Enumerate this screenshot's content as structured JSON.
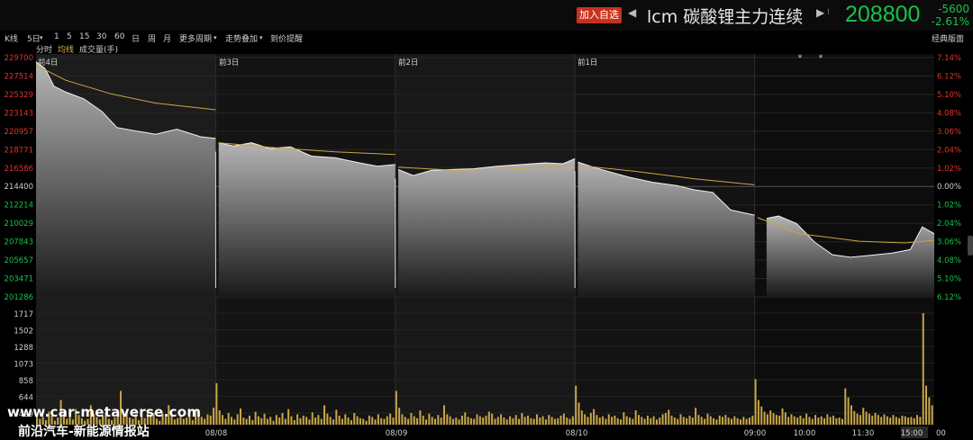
{
  "header": {
    "add_watchlist": "加入自选",
    "symbol": "lcm",
    "name": "碳酸锂主力连续",
    "price": "208800",
    "change": "-5600",
    "change_pct": "-2.61%",
    "price_color": "#17c24b"
  },
  "toolbar": {
    "items": [
      "K线",
      "5日",
      "1",
      "5",
      "15",
      "30",
      "60",
      "日",
      "周",
      "月",
      "更多周期",
      "走势叠加",
      "到价提醒"
    ],
    "right": "经典版面"
  },
  "subbar": {
    "items": [
      "分时",
      "均线",
      "成交量(手)"
    ]
  },
  "chart_data": {
    "type": "line",
    "day_labels": [
      "前4日",
      "前3日",
      "前2日",
      "前1日"
    ],
    "price_axis": [
      "229700",
      "227514",
      "225329",
      "223143",
      "220957",
      "218771",
      "216586",
      "214400",
      "212214",
      "210029",
      "207843",
      "205657",
      "203471",
      "201286"
    ],
    "pct_axis": [
      "7.14%",
      "6.12%",
      "5.10%",
      "4.08%",
      "3.06%",
      "2.04%",
      "1.02%",
      "0.00%",
      "1.02%",
      "2.04%",
      "3.06%",
      "4.08%",
      "5.10%",
      "6.12%"
    ],
    "volume_axis": [
      "1717",
      "1502",
      "1288",
      "1073",
      "858",
      "644",
      "429"
    ],
    "x_labels": [
      "08/08",
      "08/09",
      "08/10",
      "09:00",
      "10:00",
      "11:30",
      "15:00"
    ],
    "x_edge_label": "00",
    "reference_price": 214400,
    "price_series": [
      {
        "t": 0,
        "p": 229200
      },
      {
        "t": 3,
        "p": 228400
      },
      {
        "t": 6,
        "p": 226300
      },
      {
        "t": 10,
        "p": 225600
      },
      {
        "t": 16,
        "p": 224800
      },
      {
        "t": 22,
        "p": 223300
      },
      {
        "t": 27,
        "p": 221400
      },
      {
        "t": 33,
        "p": 221000
      },
      {
        "t": 40,
        "p": 220600
      },
      {
        "t": 47,
        "p": 221200
      },
      {
        "t": 55,
        "p": 220300
      },
      {
        "t": 60,
        "p": 220100
      },
      {
        "t": 61,
        "p": 219600
      },
      {
        "t": 66,
        "p": 219200
      },
      {
        "t": 72,
        "p": 219600
      },
      {
        "t": 78,
        "p": 218900
      },
      {
        "t": 85,
        "p": 219100
      },
      {
        "t": 92,
        "p": 218000
      },
      {
        "t": 100,
        "p": 217800
      },
      {
        "t": 108,
        "p": 217200
      },
      {
        "t": 114,
        "p": 216800
      },
      {
        "t": 120,
        "p": 217000
      },
      {
        "t": 121,
        "p": 216400
      },
      {
        "t": 126,
        "p": 215700
      },
      {
        "t": 132,
        "p": 216300
      },
      {
        "t": 138,
        "p": 216400
      },
      {
        "t": 146,
        "p": 216500
      },
      {
        "t": 154,
        "p": 216800
      },
      {
        "t": 162,
        "p": 217000
      },
      {
        "t": 170,
        "p": 217200
      },
      {
        "t": 176,
        "p": 217100
      },
      {
        "t": 180,
        "p": 217700
      },
      {
        "t": 181,
        "p": 217300
      },
      {
        "t": 186,
        "p": 216700
      },
      {
        "t": 192,
        "p": 216100
      },
      {
        "t": 198,
        "p": 215500
      },
      {
        "t": 206,
        "p": 214900
      },
      {
        "t": 214,
        "p": 214500
      },
      {
        "t": 220,
        "p": 214000
      },
      {
        "t": 226,
        "p": 213700
      },
      {
        "t": 232,
        "p": 211600
      },
      {
        "t": 240,
        "p": 211000
      },
      {
        "t": 244,
        "p": 210600
      },
      {
        "t": 248,
        "p": 210900
      },
      {
        "t": 254,
        "p": 210000
      },
      {
        "t": 260,
        "p": 207800
      },
      {
        "t": 266,
        "p": 206300
      },
      {
        "t": 272,
        "p": 206000
      },
      {
        "t": 278,
        "p": 206200
      },
      {
        "t": 286,
        "p": 206500
      },
      {
        "t": 292,
        "p": 206900
      },
      {
        "t": 296,
        "p": 209600
      },
      {
        "t": 300,
        "p": 208800
      }
    ],
    "avg_series": [
      {
        "t": 0,
        "p": 228800
      },
      {
        "t": 10,
        "p": 227000
      },
      {
        "t": 25,
        "p": 225400
      },
      {
        "t": 40,
        "p": 224300
      },
      {
        "t": 60,
        "p": 223500
      },
      {
        "t": 61,
        "p": 219600
      },
      {
        "t": 80,
        "p": 219000
      },
      {
        "t": 100,
        "p": 218500
      },
      {
        "t": 120,
        "p": 218200
      },
      {
        "t": 121,
        "p": 216700
      },
      {
        "t": 140,
        "p": 216300
      },
      {
        "t": 160,
        "p": 216500
      },
      {
        "t": 180,
        "p": 216900
      },
      {
        "t": 181,
        "p": 216900
      },
      {
        "t": 200,
        "p": 216200
      },
      {
        "t": 220,
        "p": 215300
      },
      {
        "t": 240,
        "p": 214600
      },
      {
        "t": 241,
        "p": 210700
      },
      {
        "t": 255,
        "p": 208800
      },
      {
        "t": 275,
        "p": 207900
      },
      {
        "t": 290,
        "p": 207700
      },
      {
        "t": 300,
        "p": 208000
      }
    ],
    "volume_series": [
      160,
      90,
      120,
      70,
      200,
      140,
      60,
      110,
      380,
      170,
      90,
      130,
      80,
      240,
      150,
      100,
      60,
      90,
      300,
      170,
      120,
      80,
      140,
      190,
      90,
      70,
      110,
      130,
      520,
      160,
      200,
      110,
      90,
      160,
      70,
      140,
      100,
      220,
      130,
      180,
      90,
      60,
      170,
      120,
      300,
      140,
      80,
      100,
      150,
      90,
      110,
      130,
      70,
      240,
      180,
      120,
      90,
      160,
      140,
      260,
      640,
      220,
      150,
      90,
      180,
      120,
      80,
      160,
      250,
      110,
      90,
      140,
      70,
      200,
      130,
      100,
      170,
      90,
      120,
      60,
      150,
      110,
      180,
      90,
      240,
      130,
      70,
      160,
      100,
      140,
      120,
      80,
      190,
      110,
      150,
      90,
      300,
      170,
      120,
      80,
      230,
      140,
      90,
      160,
      110,
      70,
      180,
      130,
      100,
      90,
      60,
      140,
      120,
      80,
      160,
      100,
      90,
      130,
      170,
      110,
      520,
      260,
      160,
      120,
      90,
      180,
      130,
      100,
      220,
      140,
      80,
      170,
      120,
      90,
      150,
      110,
      300,
      160,
      130,
      90,
      110,
      80,
      140,
      190,
      120,
      100,
      90,
      160,
      130,
      110,
      140,
      200,
      170,
      90,
      120,
      160,
      110,
      80,
      130,
      100,
      150,
      90,
      180,
      120,
      140,
      100,
      90,
      160,
      110,
      130,
      80,
      150,
      120,
      90,
      100,
      140,
      170,
      110,
      90,
      130,
      600,
      340,
      220,
      160,
      120,
      180,
      240,
      150,
      110,
      130,
      90,
      160,
      120,
      140,
      100,
      80,
      190,
      130,
      110,
      90,
      220,
      150,
      120,
      90,
      140,
      100,
      130,
      80,
      110,
      160,
      180,
      230,
      140,
      110,
      90,
      160,
      120,
      100,
      140,
      110,
      260,
      150,
      120,
      90,
      170,
      130,
      100,
      80,
      140,
      120,
      150,
      110,
      90,
      130,
      100,
      80,
      120,
      90,
      110,
      140,
      700,
      380,
      280,
      200,
      160,
      220,
      180,
      150,
      140,
      250,
      190,
      120,
      160,
      130,
      110,
      140,
      100,
      170,
      120,
      90,
      150,
      110,
      130,
      100,
      160,
      120,
      140,
      100,
      110,
      90,
      560,
      420,
      300,
      210,
      170,
      150,
      260,
      200,
      170,
      140,
      180,
      150,
      120,
      160,
      130,
      110,
      150,
      120,
      100,
      140,
      130,
      110,
      120,
      100,
      150,
      120,
      1717,
      600,
      420,
      300
    ]
  },
  "watermark": {
    "url": "www.car-metaverse.com",
    "text": "前沿汽车-新能源情报站"
  }
}
